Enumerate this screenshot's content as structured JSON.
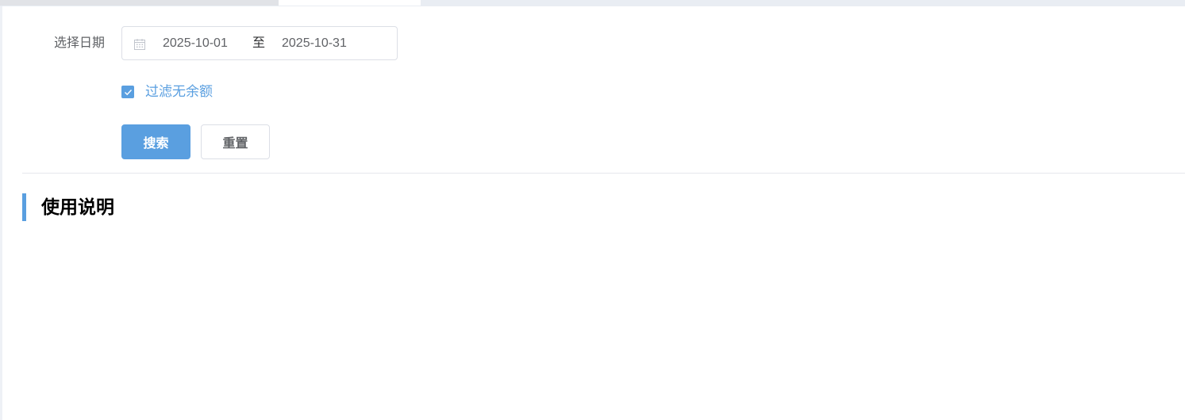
{
  "tabs": [
    {
      "label": ""
    },
    {
      "label": ""
    }
  ],
  "form": {
    "date_label": "选择日期",
    "date_start": "2025-10-01",
    "date_separator": "至",
    "date_end": "2025-10-31",
    "filter_checkbox": {
      "label": "过滤无余额",
      "checked": true
    },
    "search_button": "搜索",
    "reset_button": "重置"
  },
  "section": {
    "title": "使用说明"
  },
  "icons": {
    "date": "calendar-icon",
    "check": "check-icon"
  },
  "colors": {
    "accent": "#5a9fe0",
    "label_text": "#606266",
    "border": "#dcdfe6",
    "page_bg": "#eef1f6"
  }
}
